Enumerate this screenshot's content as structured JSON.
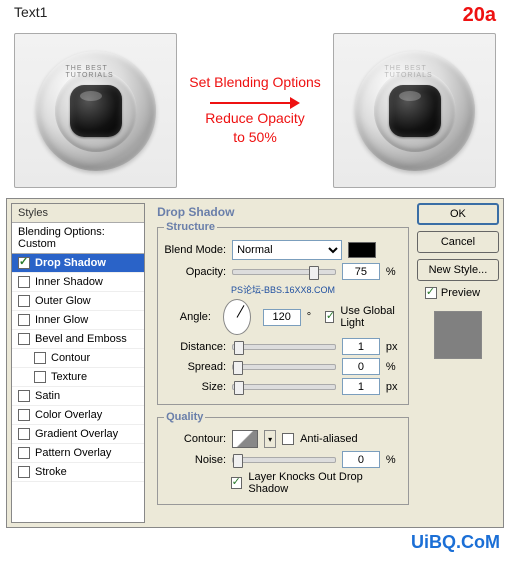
{
  "header": {
    "title": "Text1",
    "step": "20a"
  },
  "instruction": {
    "line1": "Set Blending Options",
    "line2": "Reduce Opacity",
    "line3": "to 50%"
  },
  "lens_text": "THE BEST TUTORIALS",
  "dialog": {
    "panel_title": "Drop Shadow",
    "styles_header": "Styles",
    "blending_options_label": "Blending Options: Custom",
    "style_list": [
      {
        "label": "Drop Shadow",
        "checked": true,
        "selected": true
      },
      {
        "label": "Inner Shadow",
        "checked": false
      },
      {
        "label": "Outer Glow",
        "checked": false
      },
      {
        "label": "Inner Glow",
        "checked": false
      },
      {
        "label": "Bevel and Emboss",
        "checked": false
      },
      {
        "label": "Contour",
        "checked": false,
        "indented": true
      },
      {
        "label": "Texture",
        "checked": false,
        "indented": true
      },
      {
        "label": "Satin",
        "checked": false
      },
      {
        "label": "Color Overlay",
        "checked": false
      },
      {
        "label": "Gradient Overlay",
        "checked": false
      },
      {
        "label": "Pattern Overlay",
        "checked": false
      },
      {
        "label": "Stroke",
        "checked": false
      }
    ],
    "structure_legend": "Structure",
    "quality_legend": "Quality",
    "labels": {
      "blend_mode": "Blend Mode:",
      "opacity": "Opacity:",
      "angle": "Angle:",
      "use_global_light": "Use Global Light",
      "distance": "Distance:",
      "spread": "Spread:",
      "size": "Size:",
      "contour": "Contour:",
      "anti_aliased": "Anti-aliased",
      "noise": "Noise:",
      "layer_knocks": "Layer Knocks Out Drop Shadow"
    },
    "values": {
      "blend_mode": "Normal",
      "opacity": "75",
      "opacity_unit": "%",
      "angle": "120",
      "angle_unit": "°",
      "use_global_light": true,
      "distance": "1",
      "distance_unit": "px",
      "spread": "0",
      "spread_unit": "%",
      "size": "1",
      "size_unit": "px",
      "anti_aliased": false,
      "noise": "0",
      "noise_unit": "%",
      "layer_knocks": true
    },
    "link_text": "PS论坛-BBS.16XX8.COM",
    "buttons": {
      "ok": "OK",
      "cancel": "Cancel",
      "new_style": "New Style...",
      "preview": "Preview"
    }
  },
  "watermark": "UiBQ.CoM"
}
